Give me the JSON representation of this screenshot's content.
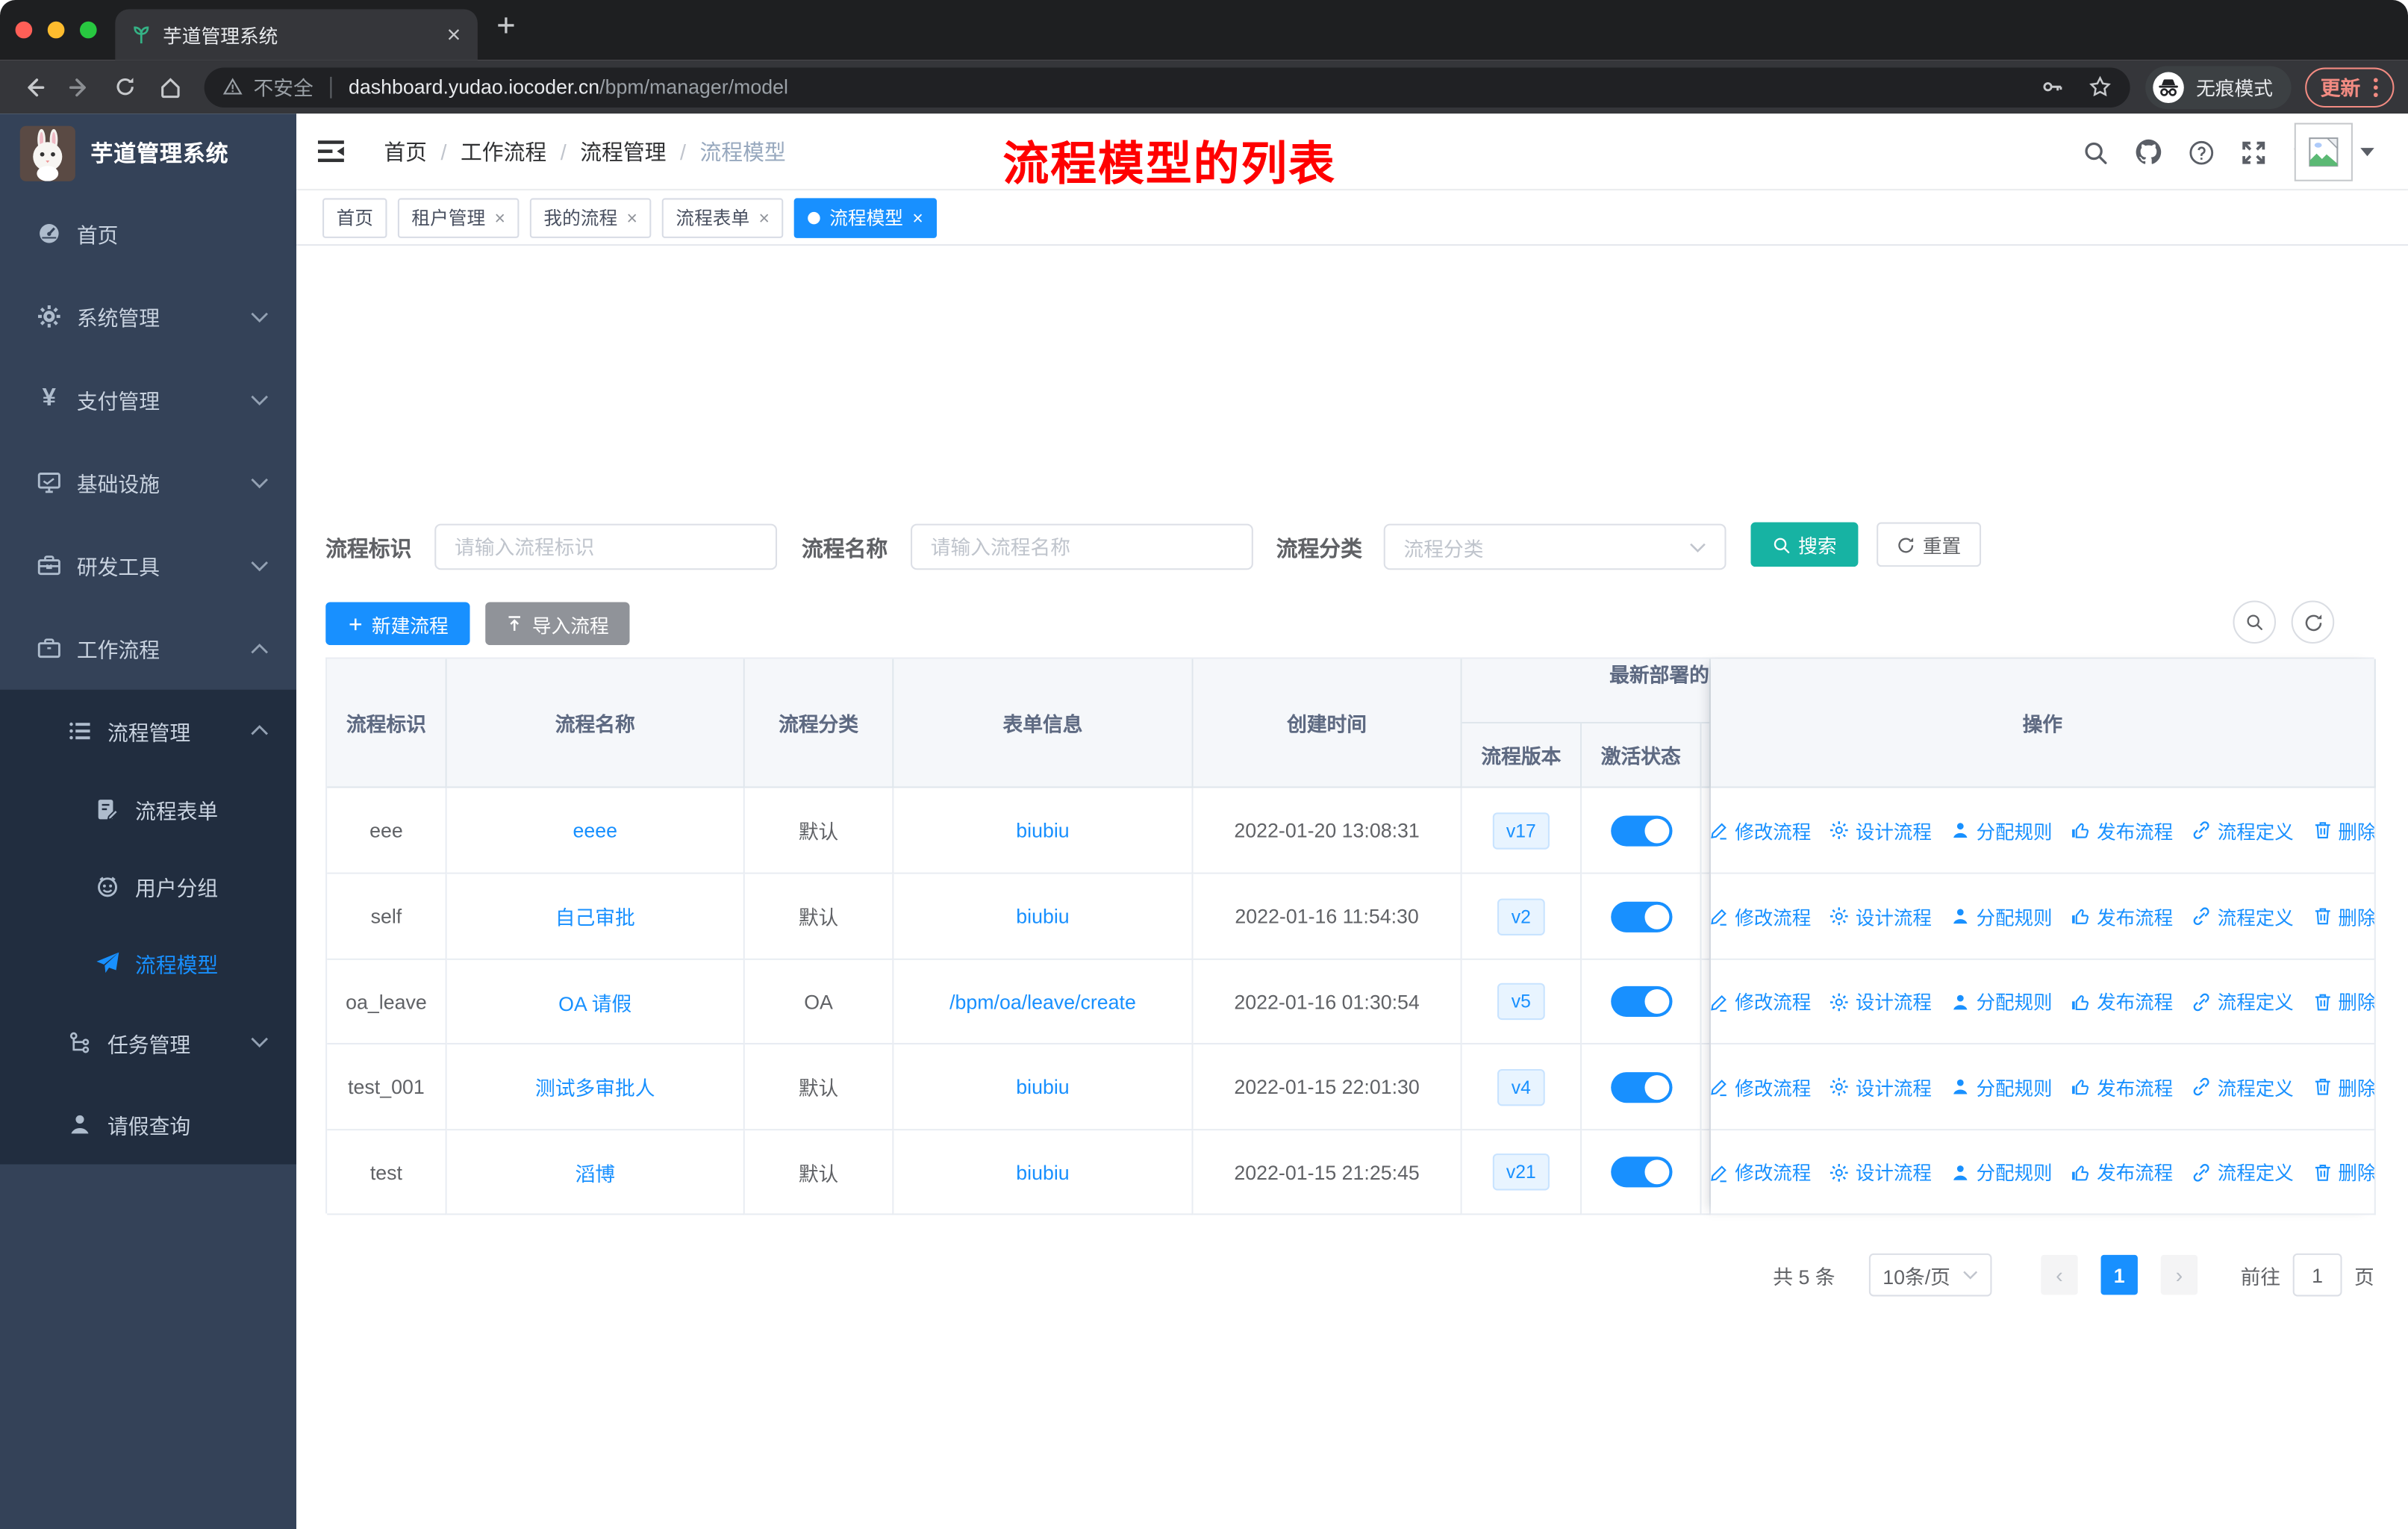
{
  "colors": {
    "primary": "#1890ff",
    "teal": "#17b3a3",
    "annotation_red": "#ff0000",
    "sidebar_bg": "#344258",
    "submenu_bg": "#212d3f"
  },
  "browser": {
    "tab_title": "芋道管理系统",
    "not_secure": "不安全",
    "url_host": "dashboard.yudao.iocoder.cn",
    "url_path": "/bpm/manager/model",
    "incognito_label": "无痕模式",
    "update_label": "更新"
  },
  "sidebar": {
    "title": "芋道管理系统",
    "items": [
      {
        "label": "首页",
        "icon": "dashboard-icon",
        "level": 1,
        "chevron": "",
        "sub": false,
        "active": false
      },
      {
        "label": "系统管理",
        "icon": "gear-icon",
        "level": 1,
        "chevron": "down",
        "sub": false,
        "active": false
      },
      {
        "label": "支付管理",
        "icon": "yen-icon",
        "level": 1,
        "chevron": "down",
        "sub": false,
        "active": false
      },
      {
        "label": "基础设施",
        "icon": "monitor-icon",
        "level": 1,
        "chevron": "down",
        "sub": false,
        "active": false
      },
      {
        "label": "研发工具",
        "icon": "toolbox-icon",
        "level": 1,
        "chevron": "down",
        "sub": false,
        "active": false
      },
      {
        "label": "工作流程",
        "icon": "briefcase-icon",
        "level": 1,
        "chevron": "up",
        "sub": false,
        "active": false
      },
      {
        "label": "流程管理",
        "icon": "list-icon",
        "level": 2,
        "chevron": "up",
        "sub": true,
        "active": false
      },
      {
        "label": "流程表单",
        "icon": "form-icon",
        "level": 3,
        "chevron": "",
        "sub": true,
        "active": false
      },
      {
        "label": "用户分组",
        "icon": "group-icon",
        "level": 3,
        "chevron": "",
        "sub": true,
        "active": false
      },
      {
        "label": "流程模型",
        "icon": "send-icon",
        "level": 3,
        "chevron": "",
        "sub": true,
        "active": true
      },
      {
        "label": "任务管理",
        "icon": "tree-icon",
        "level": 2,
        "chevron": "down",
        "sub": true,
        "active": false
      },
      {
        "label": "请假查询",
        "icon": "user-icon",
        "level": 2,
        "chevron": "",
        "sub": true,
        "active": false
      }
    ]
  },
  "topbar": {
    "breadcrumb": [
      "首页",
      "工作流程",
      "流程管理",
      "流程模型"
    ],
    "annotation": "流程模型的列表"
  },
  "tags": [
    {
      "label": "首页",
      "closable": false,
      "active": false
    },
    {
      "label": "租户管理",
      "closable": true,
      "active": false
    },
    {
      "label": "我的流程",
      "closable": true,
      "active": false
    },
    {
      "label": "流程表单",
      "closable": true,
      "active": false
    },
    {
      "label": "流程模型",
      "closable": true,
      "active": true
    }
  ],
  "filters": {
    "id_label": "流程标识",
    "id_placeholder": "请输入流程标识",
    "name_label": "流程名称",
    "name_placeholder": "请输入流程名称",
    "category_label": "流程分类",
    "category_placeholder": "流程分类",
    "search_label": "搜索",
    "reset_label": "重置"
  },
  "toolbar": {
    "create_label": "新建流程",
    "import_label": "导入流程"
  },
  "table": {
    "columns": {
      "id": "流程标识",
      "name": "流程名称",
      "category": "流程分类",
      "form": "表单信息",
      "created": "创建时间",
      "group": "最新部署的",
      "version": "流程版本",
      "status": "激活状态",
      "actions": "操作"
    },
    "rows": [
      {
        "id": "eee",
        "name": "eeee",
        "category": "默认",
        "form": "biubiu",
        "created": "2022-01-20 13:08:31",
        "version": "v17",
        "active": true
      },
      {
        "id": "self",
        "name": "自己审批",
        "category": "默认",
        "form": "biubiu",
        "created": "2022-01-16 11:54:30",
        "version": "v2",
        "active": true
      },
      {
        "id": "oa_leave",
        "name": "OA 请假",
        "category": "OA",
        "form": "/bpm/oa/leave/create",
        "created": "2022-01-16 01:30:54",
        "version": "v5",
        "active": true
      },
      {
        "id": "test_001",
        "name": "测试多审批人",
        "category": "默认",
        "form": "biubiu",
        "created": "2022-01-15 22:01:30",
        "version": "v4",
        "active": true
      },
      {
        "id": "test",
        "name": "滔博",
        "category": "默认",
        "form": "biubiu",
        "created": "2022-01-15 21:25:45",
        "version": "v21",
        "active": true
      }
    ],
    "row_actions": [
      {
        "label": "修改流程",
        "icon": "edit-icon"
      },
      {
        "label": "设计流程",
        "icon": "design-gear-icon"
      },
      {
        "label": "分配规则",
        "icon": "assign-user-icon"
      },
      {
        "label": "发布流程",
        "icon": "publish-icon"
      },
      {
        "label": "流程定义",
        "icon": "definition-link-icon"
      },
      {
        "label": "删除",
        "icon": "delete-icon"
      }
    ]
  },
  "pagination": {
    "total": "共 5 条",
    "page_size": "10条/页",
    "current": "1",
    "prev": "‹",
    "next": "›",
    "goto_label": "前往",
    "goto_value": "1",
    "unit": "页"
  }
}
